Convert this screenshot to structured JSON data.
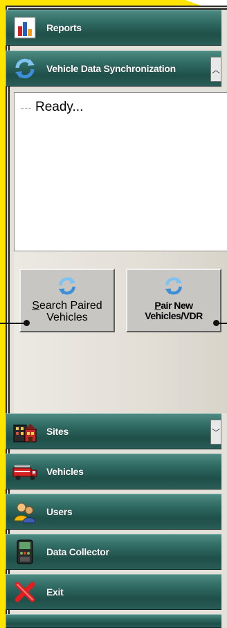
{
  "nav": {
    "reports_label": "Reports",
    "sync_label": "Vehicle Data Synchronization",
    "sites_label": "Sites",
    "vehicles_label": "Vehicles",
    "users_label": "Users",
    "data_collector_label": "Data Collector",
    "exit_label": "Exit"
  },
  "status": {
    "text": "Ready..."
  },
  "actions": {
    "search_paired": {
      "line1_underlined": "S",
      "line1_rest": "earch Paired",
      "line2": "Vehicles"
    },
    "pair_new": {
      "line1_underlined": "P",
      "line1_rest": "air New",
      "line2": "Vehicles/VDR"
    }
  },
  "colors": {
    "bar_top": "#4d8a82",
    "bar_bottom": "#1f4f49",
    "highlight_yellow": "#ffe400",
    "button_face": "#c8c6c2"
  },
  "icons": {
    "reports": "bar-chart-icon",
    "sync": "sync-arrows-icon",
    "sites": "building-icon",
    "vehicles": "fire-truck-icon",
    "users": "users-icon",
    "data_collector": "device-icon",
    "exit": "red-x-icon"
  }
}
